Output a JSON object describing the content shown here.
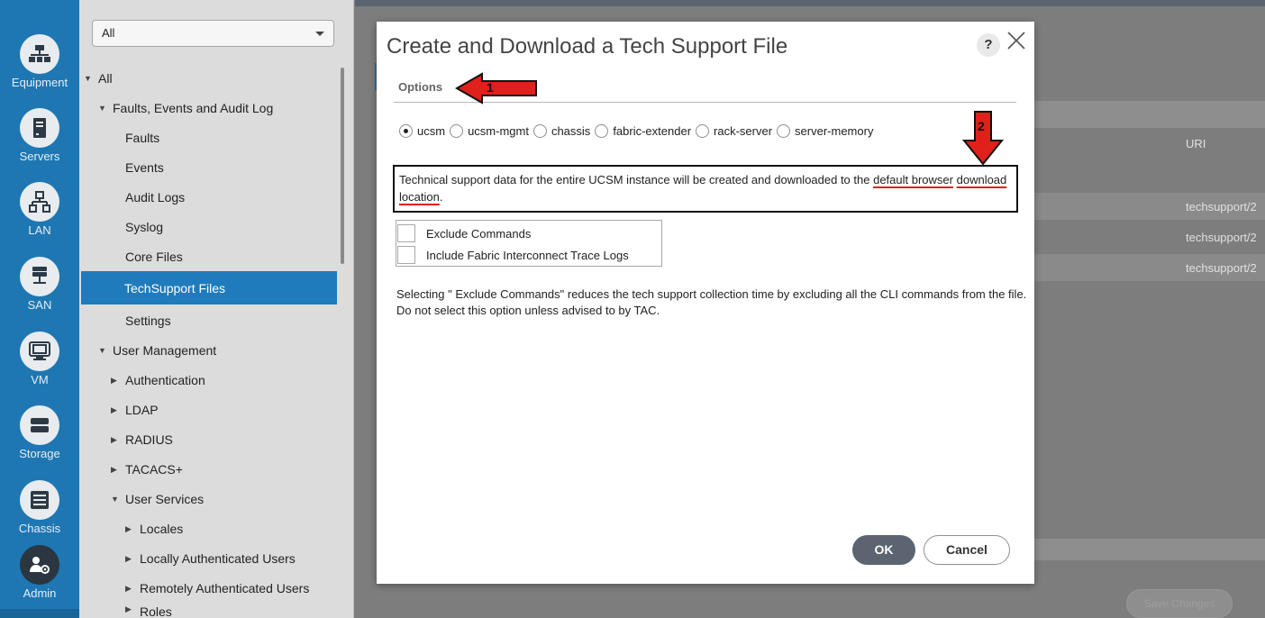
{
  "rail": {
    "items": [
      {
        "label": "Equipment",
        "icon": "equipment-icon"
      },
      {
        "label": "Servers",
        "icon": "servers-icon"
      },
      {
        "label": "LAN",
        "icon": "lan-icon"
      },
      {
        "label": "SAN",
        "icon": "san-icon"
      },
      {
        "label": "VM",
        "icon": "vm-icon"
      },
      {
        "label": "Storage",
        "icon": "storage-icon"
      },
      {
        "label": "Chassis",
        "icon": "chassis-icon"
      },
      {
        "label": "Admin",
        "icon": "admin-icon"
      }
    ],
    "active": "Admin"
  },
  "nav": {
    "filter_value": "All",
    "tree": [
      {
        "label": "All",
        "expanded": true
      },
      {
        "label": "Faults, Events and Audit Log",
        "expanded": true
      },
      {
        "label": "Faults"
      },
      {
        "label": "Events"
      },
      {
        "label": "Audit Logs"
      },
      {
        "label": "Syslog"
      },
      {
        "label": "Core Files"
      },
      {
        "label": "TechSupport Files",
        "selected": true
      },
      {
        "label": "Settings"
      },
      {
        "label": "User Management",
        "expanded": true
      },
      {
        "label": "Authentication",
        "expanded": false
      },
      {
        "label": "LDAP",
        "expanded": false
      },
      {
        "label": "RADIUS",
        "expanded": false
      },
      {
        "label": "TACACS+",
        "expanded": false
      },
      {
        "label": "User Services",
        "expanded": true
      },
      {
        "label": "Locales",
        "expanded": false
      },
      {
        "label": "Locally Authenticated Users",
        "expanded": false
      },
      {
        "label": "Remotely Authenticated Users",
        "expanded": false
      },
      {
        "label": "Roles",
        "expanded": false
      }
    ]
  },
  "background": {
    "column_header": "URI",
    "rows": [
      "techsupport/2",
      "techsupport/2",
      "techsupport/2"
    ],
    "save_label": "Save Changes"
  },
  "dialog": {
    "title": "Create and Download a Tech Support File",
    "help_label": "?",
    "close_label": "×",
    "tab_label": "Options",
    "radio_options": [
      {
        "label": "ucsm",
        "checked": true
      },
      {
        "label": "ucsm-mgmt",
        "checked": false
      },
      {
        "label": "chassis",
        "checked": false
      },
      {
        "label": "fabric-extender",
        "checked": false
      },
      {
        "label": "rack-server",
        "checked": false
      },
      {
        "label": "server-memory",
        "checked": false
      }
    ],
    "description_prefix": "Technical support data for the entire UCSM instance will be created and downloaded to the ",
    "description_highlight_1": "default browser",
    "description_highlight_2": "download location",
    "description_suffix": ".",
    "checkboxes": [
      {
        "label": "Exclude Commands",
        "checked": false
      },
      {
        "label": "Include Fabric Interconnect Trace Logs",
        "checked": false
      }
    ],
    "note": "Selecting \" Exclude Commands\"  reduces the tech support collection time by excluding all the CLI commands from the file. Do not select this option unless advised to by TAC.",
    "ok_label": "OK",
    "cancel_label": "Cancel"
  },
  "annotations": [
    {
      "number": "1",
      "color": "#e0201b"
    },
    {
      "number": "2",
      "color": "#e0201b"
    }
  ]
}
